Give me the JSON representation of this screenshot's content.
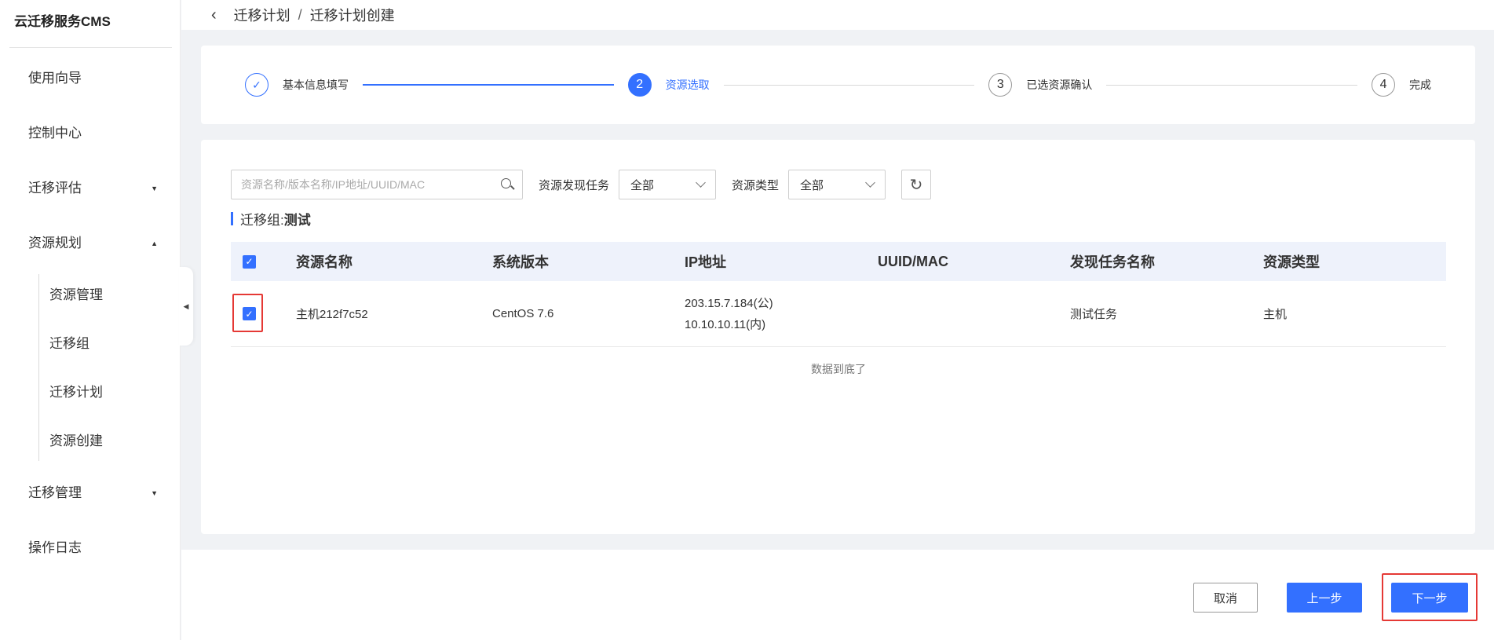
{
  "app": {
    "title": "云迁移服务CMS"
  },
  "sidebar": {
    "items": [
      {
        "label": "使用向导",
        "caret": ""
      },
      {
        "label": "控制中心",
        "caret": ""
      },
      {
        "label": "迁移评估",
        "caret": "▼"
      },
      {
        "label": "资源规划",
        "caret": "▲"
      },
      {
        "label": "迁移管理",
        "caret": "▼"
      },
      {
        "label": "操作日志",
        "caret": ""
      }
    ],
    "subitems": [
      "资源管理",
      "迁移组",
      "迁移计划",
      "资源创建"
    ],
    "collapse_icon": "◀"
  },
  "breadcrumb": {
    "back_icon": "‹",
    "parent": "迁移计划",
    "separator": "/",
    "current": "迁移计划创建"
  },
  "steps": [
    {
      "index": "1",
      "label": "基本信息填写",
      "status": "done",
      "check": "✓"
    },
    {
      "index": "2",
      "label": "资源选取",
      "status": "active"
    },
    {
      "index": "3",
      "label": "已选资源确认",
      "status": "pending"
    },
    {
      "index": "4",
      "label": "完成",
      "status": "pending"
    }
  ],
  "filters": {
    "search_placeholder": "资源名称/版本名称/IP地址/UUID/MAC",
    "task_label": "资源发现任务",
    "task_value": "全部",
    "type_label": "资源类型",
    "type_value": "全部",
    "refresh_icon": "↻"
  },
  "group": {
    "prefix": "迁移组:",
    "name": "测试"
  },
  "table": {
    "headers": [
      "资源名称",
      "系统版本",
      "IP地址",
      "UUID/MAC",
      "发现任务名称",
      "资源类型"
    ],
    "rows": [
      {
        "checked": "✓",
        "name": "主机212f7c52",
        "os": "CentOS 7.6",
        "ip_public": "203.15.7.184(公)",
        "ip_private": "10.10.10.11(内)",
        "uuid": "",
        "task": "测试任务",
        "type": "主机"
      }
    ],
    "empty_hint": "数据到底了",
    "header_check": "✓"
  },
  "footer": {
    "cancel": "取消",
    "prev": "上一步",
    "next": "下一步"
  },
  "colors": {
    "accent": "#3370ff",
    "highlight": "#e53935"
  }
}
